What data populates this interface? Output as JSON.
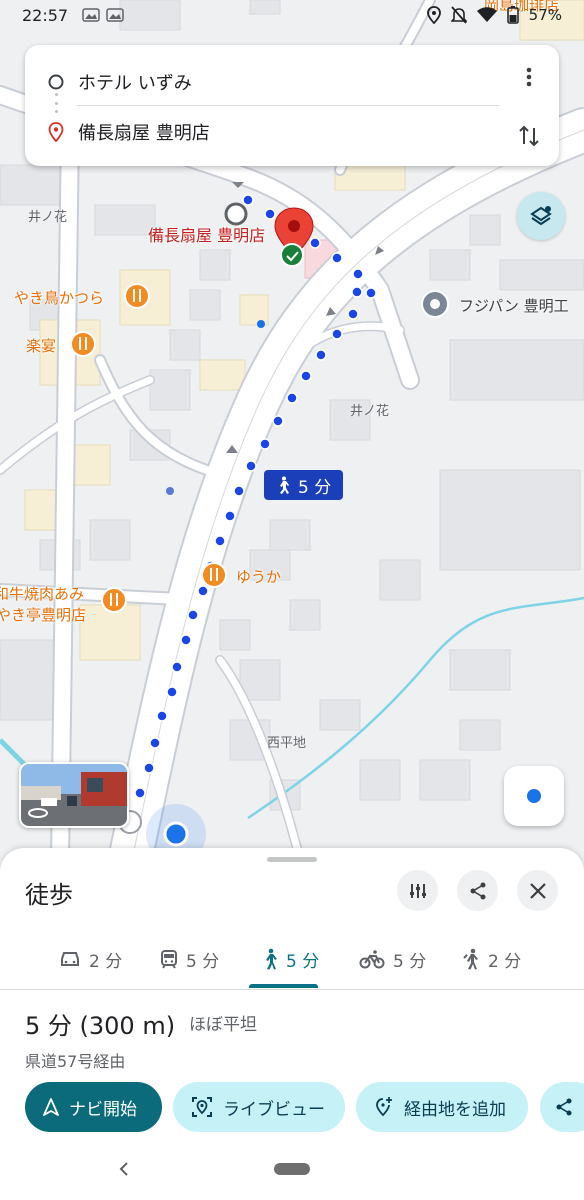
{
  "status_bar": {
    "time": "22:57",
    "battery": "57%",
    "icons": [
      "location-icon",
      "mute-icon",
      "wifi-icon",
      "battery-icon"
    ]
  },
  "route": {
    "origin": "ホテル いずみ",
    "destination": "備長扇屋 豊明店"
  },
  "map": {
    "labels": {
      "top_right_cut": "岡島珈琲店",
      "inohana_left": "井ノ花",
      "inohana_right": "井ノ花",
      "nishihirachi": "西平地",
      "dest_label": "備長扇屋 豊明店",
      "yakitori": "やき鳥かつら",
      "rakuen": "楽宴",
      "yuka": "ゆうか",
      "yakiniku_line1": "和牛焼肉あみ",
      "yakiniku_line2": "やき亭豊明店",
      "fujipan": "フジパン 豊明工"
    },
    "walk_time": "5 分",
    "colors": {
      "route": "#1a46e8",
      "water": "#7fd3e6",
      "road": "#ffffff",
      "background": "#eef0f2"
    }
  },
  "sheet": {
    "title": "徒歩",
    "modes": [
      {
        "icon": "car-icon",
        "label": "2 分"
      },
      {
        "icon": "transit-icon",
        "label": "5 分"
      },
      {
        "icon": "walk-icon",
        "label": "5 分"
      },
      {
        "icon": "bike-icon",
        "label": "5 分"
      },
      {
        "icon": "ride-icon",
        "label": "2 分"
      }
    ],
    "active_mode": "walk",
    "summary": "5 分 (300 m)",
    "summary_note": "ほぼ平坦",
    "via": "県道57号経由",
    "chips": {
      "start": "ナビ開始",
      "liveview": "ライブビュー",
      "add_stop": "経由地を追加"
    },
    "accent": "#0b7285"
  }
}
